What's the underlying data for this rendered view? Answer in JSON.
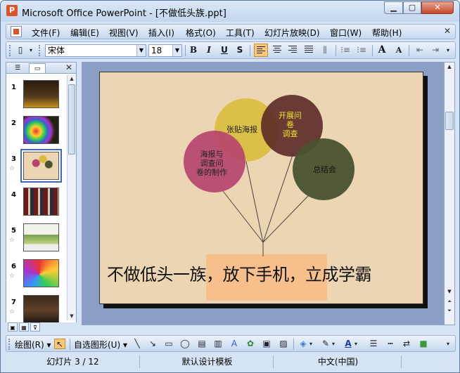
{
  "window": {
    "title": "Microsoft Office PowerPoint - [不做低头族.ppt]",
    "min_label": "▁",
    "max_label": "▢",
    "close_label": "✕"
  },
  "menu": {
    "items": [
      "文件(F)",
      "编辑(E)",
      "视图(V)",
      "插入(I)",
      "格式(O)",
      "工具(T)",
      "幻灯片放映(D)",
      "窗口(W)",
      "帮助(H)"
    ],
    "close_label": "✕"
  },
  "format_toolbar": {
    "font_name": "宋体",
    "font_size": "18",
    "bold": "B",
    "italic": "I",
    "underline": "U",
    "shadow": "S",
    "grow_font": "A",
    "shrink_font": "A"
  },
  "left_pane": {
    "tab_outline_icon": "outline-icon",
    "tab_slides_icon": "slides-icon",
    "close_label": "✕",
    "slides": [
      {
        "num": "1",
        "has_star": false
      },
      {
        "num": "2",
        "has_star": false
      },
      {
        "num": "3",
        "has_star": true,
        "selected": true
      },
      {
        "num": "4",
        "has_star": false
      },
      {
        "num": "5",
        "has_star": true
      },
      {
        "num": "6",
        "has_star": true
      },
      {
        "num": "7",
        "has_star": true
      }
    ]
  },
  "slide": {
    "balloons": [
      {
        "label": "张贴海报"
      },
      {
        "label": "开展问\n卷\n调查"
      },
      {
        "label": "海报与\n调查问\n卷的制作"
      },
      {
        "label": "总结会"
      }
    ],
    "colors": {
      "background": "#ecd5b3",
      "yellow": "#d8bd3c",
      "dark_red": "#5b2a26",
      "pink": "#b5436d",
      "dark_green": "#4a5230",
      "highlight": "#f7bf8c"
    },
    "title": "不做低头一族，放下手机，立成学霸"
  },
  "draw_toolbar": {
    "draw_label": "绘图(R)",
    "autoshape_label": "自选图形(U)"
  },
  "status": {
    "slide_position": "幻灯片 3 / 12",
    "template": "默认设计模板",
    "language": "中文(中国)"
  }
}
